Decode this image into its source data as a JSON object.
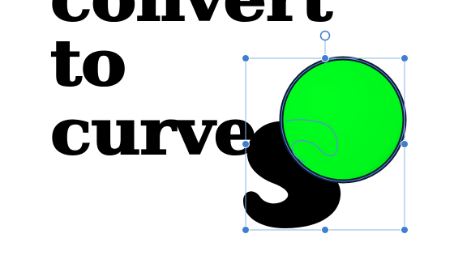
{
  "canvas": {
    "lines": [
      "convert",
      "to",
      "curve"
    ],
    "colors": {
      "text": "#000000",
      "shape_fill": "#00ff1f",
      "shape_outline": "#0d1a33",
      "selection": "#5b8fd6",
      "handle": "#3f7fd0"
    }
  },
  "selection": {
    "handles": [
      "top-left",
      "top-center",
      "top-right",
      "middle-left",
      "middle-right",
      "bottom-left",
      "bottom-center",
      "bottom-right"
    ],
    "rotate_handle": "rotate-handle-icon"
  }
}
